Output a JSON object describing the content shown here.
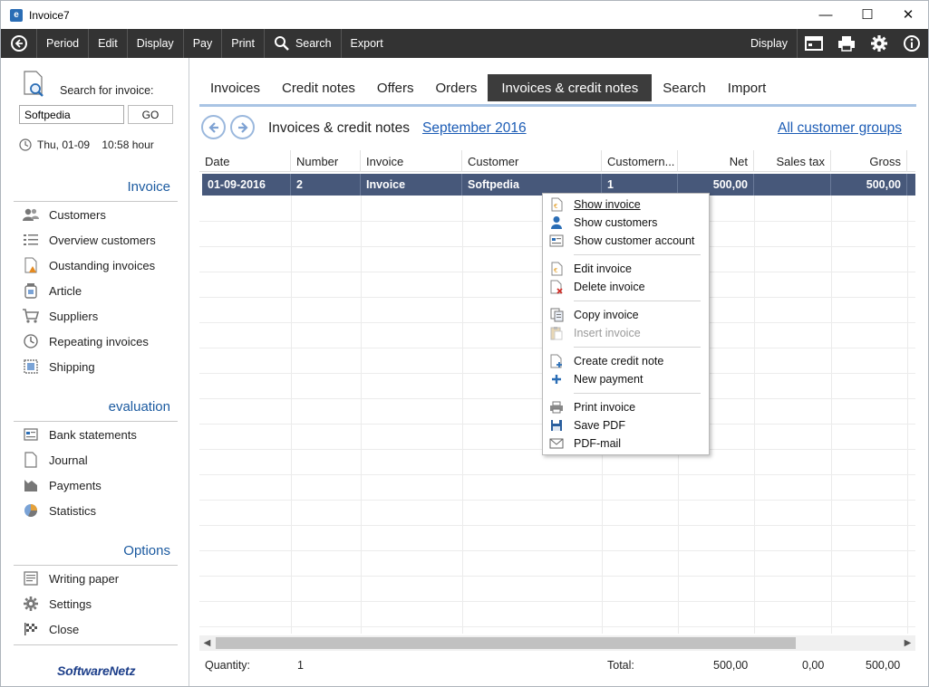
{
  "window": {
    "title": "Invoice7",
    "app_icon_letter": "e",
    "minimize": "—",
    "maximize": "☐",
    "close": "✕"
  },
  "toolbar": {
    "back_icon": "arrow-left-icon",
    "items": [
      "Period",
      "Edit",
      "Display",
      "Pay",
      "Print",
      "Search",
      "Export"
    ],
    "right_label": "Display"
  },
  "sidebar": {
    "search_label": "Search for invoice:",
    "search_value": "Softpedia",
    "go_label": "GO",
    "date_text": "Thu, 01-09    10:58 hour",
    "sections": [
      {
        "title": "Invoice",
        "items": [
          "Customers",
          "Overview customers",
          "Oustanding invoices",
          "Article",
          "Suppliers",
          "Repeating invoices",
          "Shipping"
        ]
      },
      {
        "title": "evaluation",
        "items": [
          "Bank statements",
          "Journal",
          "Payments",
          "Statistics"
        ]
      },
      {
        "title": "Options",
        "items": [
          "Writing paper",
          "Settings",
          "Close"
        ]
      }
    ],
    "brand": "SoftwareNetz"
  },
  "main": {
    "tabs": [
      "Invoices",
      "Credit notes",
      "Offers",
      "Orders",
      "Invoices & credit notes",
      "Search",
      "Import"
    ],
    "active_tab": "Invoices & credit notes",
    "view_title": "Invoices & credit notes",
    "period": "September 2016",
    "customer_groups": "All customer groups",
    "columns": [
      "Date",
      "Number",
      "Invoice",
      "Customer",
      "Customern...",
      "Net",
      "Sales tax",
      "Gross"
    ],
    "rows": [
      {
        "date": "01-09-2016",
        "number": "2",
        "invoice": "Invoice",
        "customer": "Softpedia",
        "customer_no": "1",
        "net": "500,00",
        "sales_tax": "",
        "gross": "500,00"
      }
    ],
    "footer": {
      "quantity_label": "Quantity:",
      "quantity": "1",
      "total_label": "Total:",
      "net_total": "500,00",
      "tax_total": "0,00",
      "gross_total": "500,00"
    }
  },
  "context_menu": {
    "groups": [
      [
        {
          "label": "Show invoice",
          "icon": "invoice-icon",
          "enabled": true
        },
        {
          "label": "Show customers",
          "icon": "person-icon",
          "enabled": true
        },
        {
          "label": "Show customer account",
          "icon": "account-icon",
          "enabled": true
        }
      ],
      [
        {
          "label": "Edit invoice",
          "icon": "edit-invoice-icon",
          "enabled": true
        },
        {
          "label": "Delete invoice",
          "icon": "delete-invoice-icon",
          "enabled": true
        }
      ],
      [
        {
          "label": "Copy invoice",
          "icon": "copy-icon",
          "enabled": true
        },
        {
          "label": "Insert invoice",
          "icon": "paste-icon",
          "enabled": false
        }
      ],
      [
        {
          "label": "Create credit note",
          "icon": "credit-note-icon",
          "enabled": true
        },
        {
          "label": "New payment",
          "icon": "plus-icon",
          "enabled": true
        }
      ],
      [
        {
          "label": "Print invoice",
          "icon": "printer-icon",
          "enabled": true
        },
        {
          "label": "Save PDF",
          "icon": "save-icon",
          "enabled": true
        },
        {
          "label": "PDF-mail",
          "icon": "mail-icon",
          "enabled": true
        }
      ]
    ]
  },
  "colors": {
    "toolbar_bg": "#333333",
    "selected_row": "#47587a",
    "active_tab": "#3c3c3c",
    "link": "#1c5cb5",
    "section_head": "#1b5aa0"
  }
}
